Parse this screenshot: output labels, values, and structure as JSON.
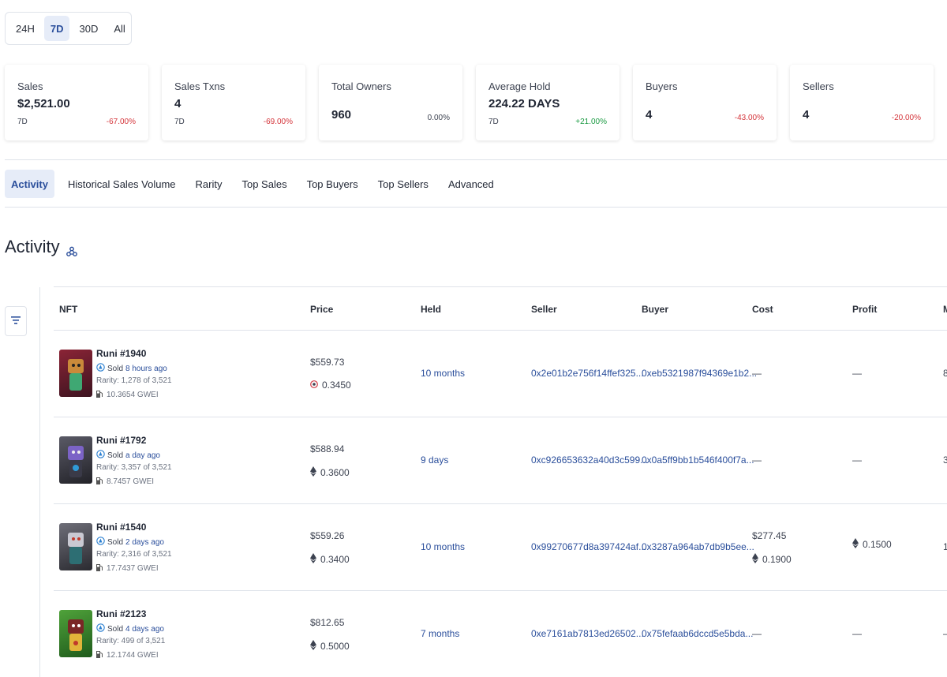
{
  "range": {
    "options": [
      "24H",
      "7D",
      "30D",
      "All"
    ],
    "active": "7D"
  },
  "stats": [
    {
      "title": "Sales",
      "value": "$2,521.00",
      "period": "7D",
      "change": "-67.00%",
      "trend": "neg"
    },
    {
      "title": "Sales Txns",
      "value": "4",
      "period": "7D",
      "change": "-69.00%",
      "trend": "neg"
    },
    {
      "title": "Total Owners",
      "value": "960",
      "period": "",
      "change": "0.00%",
      "trend": "neu"
    },
    {
      "title": "Average Hold",
      "value": "224.22 DAYS",
      "period": "7D",
      "change": "+21.00%",
      "trend": "pos"
    },
    {
      "title": "Buyers",
      "value": "4",
      "period": "",
      "change": "-43.00%",
      "trend": "neg"
    },
    {
      "title": "Sellers",
      "value": "4",
      "period": "",
      "change": "-20.00%",
      "trend": "neg"
    }
  ],
  "tabs": [
    "Activity",
    "Historical Sales Volume",
    "Rarity",
    "Top Sales",
    "Top Buyers",
    "Top Sellers",
    "Advanced"
  ],
  "section_title": "Activity",
  "table": {
    "headers": {
      "nft": "NFT",
      "price": "Price",
      "held": "Held",
      "seller": "Seller",
      "buyer": "Buyer",
      "cost": "Cost",
      "profit": "Profit",
      "more": "M"
    },
    "rows": [
      {
        "name": "Runi #1940",
        "sold_label": "Sold",
        "sold_ago": "8 hours ago",
        "rarity": "Rarity: 1,278 of 3,521",
        "gas": "10.3654 GWEI",
        "price_usd": "$559.73",
        "price_eth": "0.3450",
        "price_icon": "weth-icon",
        "held": "10 months",
        "seller": "0x2e01b2e756f14ffef325...",
        "buyer": "0xeb5321987f94369e1b2...",
        "cost_usd": "",
        "cost_eth": "",
        "cost_dash": "—",
        "profit": "—",
        "more": "8",
        "thumb_color": "#7a2030"
      },
      {
        "name": "Runi #1792",
        "sold_label": "Sold",
        "sold_ago": "a day ago",
        "rarity": "Rarity: 3,357 of 3,521",
        "gas": "8.7457 GWEI",
        "price_usd": "$588.94",
        "price_eth": "0.3600",
        "price_icon": "eth-icon",
        "held": "9 days",
        "seller": "0xc926653632a40d3c599...",
        "buyer": "0x0a5ff9bb1b546f400f7a...",
        "cost_usd": "",
        "cost_eth": "",
        "cost_dash": "—",
        "profit": "—",
        "more": "3",
        "thumb_color": "#3a3a44"
      },
      {
        "name": "Runi #1540",
        "sold_label": "Sold",
        "sold_ago": "2 days ago",
        "rarity": "Rarity: 2,316 of 3,521",
        "gas": "17.7437 GWEI",
        "price_usd": "$559.26",
        "price_eth": "0.3400",
        "price_icon": "eth-icon",
        "held": "10 months",
        "seller": "0x99270677d8a397424af...",
        "buyer": "0x3287a964ab7db9b5ee...",
        "cost_usd": "$277.45",
        "cost_eth": "0.1900",
        "cost_dash": "",
        "profit": "0.1500",
        "more": "1",
        "thumb_color": "#4a4a52"
      },
      {
        "name": "Runi #2123",
        "sold_label": "Sold",
        "sold_ago": "4 days ago",
        "rarity": "Rarity: 499 of 3,521",
        "gas": "12.1744 GWEI",
        "price_usd": "$812.65",
        "price_eth": "0.5000",
        "price_icon": "eth-icon",
        "held": "7 months",
        "seller": "0xe7161ab7813ed26502...",
        "buyer": "0x75fefaab6dccd5e5bda...",
        "cost_usd": "",
        "cost_eth": "",
        "cost_dash": "—",
        "profit": "—",
        "more": "—",
        "thumb_color": "#3f8a2a"
      }
    ]
  },
  "colors": {
    "accent": "#2a4e9b",
    "negative": "#d4343a",
    "positive": "#1a9a42",
    "border": "#dfe3ea"
  }
}
